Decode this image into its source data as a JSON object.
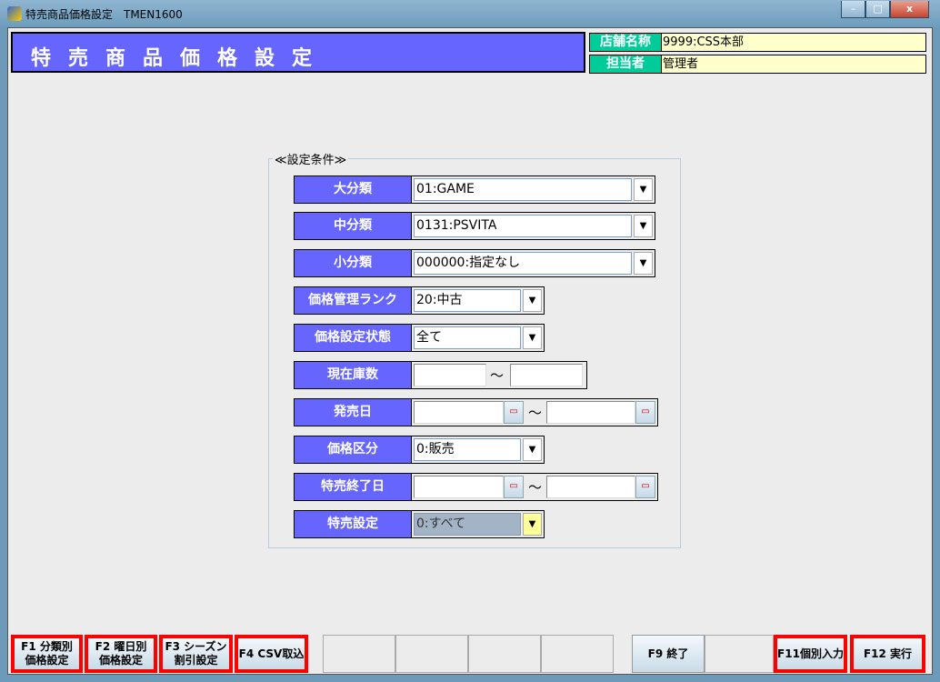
{
  "window": {
    "title": "特売商品価格設定　TMEN1600",
    "minimize": "–",
    "maximize": "□",
    "close": "x"
  },
  "header": {
    "title": "特売商品価格設定",
    "store_label": "店舗名称",
    "store_value": "9999:CSS本部",
    "staff_label": "担当者",
    "staff_value": "管理者"
  },
  "group": {
    "title": "≪設定条件≫"
  },
  "fields": {
    "major": {
      "label": "大分類",
      "value": "01:GAME"
    },
    "middle": {
      "label": "中分類",
      "value": "0131:PSVITA"
    },
    "minor": {
      "label": "小分類",
      "value": "000000:指定なし"
    },
    "rank": {
      "label": "価格管理ランク",
      "value": "20:中古"
    },
    "status": {
      "label": "価格設定状態",
      "value": "全て"
    },
    "stock": {
      "label": "現在庫数",
      "from": "",
      "to": ""
    },
    "release": {
      "label": "発売日",
      "from": "",
      "to": ""
    },
    "price_type": {
      "label": "価格区分",
      "value": "0:販売"
    },
    "sale_end": {
      "label": "特売終了日",
      "from": "",
      "to": ""
    },
    "sale_setting": {
      "label": "特売設定",
      "value": "0:すべて"
    },
    "tilde": "～"
  },
  "fkeys": {
    "f1": [
      "F1 分類別",
      "価格設定"
    ],
    "f2": [
      "F2 曜日別",
      "価格設定"
    ],
    "f3": [
      "F3 シーズン",
      "割引設定"
    ],
    "f4": "F4 CSV取込",
    "f9": "F9 終了",
    "f11": "F11個別入力",
    "f12": "F12 実行"
  }
}
